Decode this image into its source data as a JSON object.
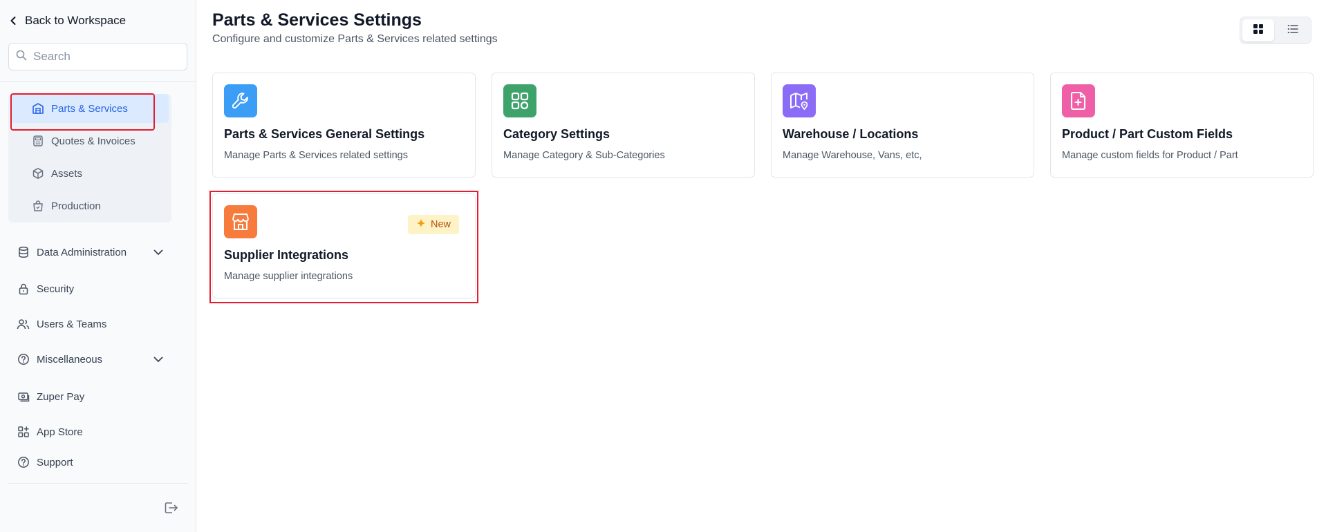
{
  "sidebar": {
    "back_label": "Back to Workspace",
    "search_placeholder": "Search",
    "submenu": [
      {
        "label": "Parts & Services",
        "icon": "building-icon",
        "active": true
      },
      {
        "label": "Quotes & Invoices",
        "icon": "calculator-icon",
        "active": false
      },
      {
        "label": "Assets",
        "icon": "cube-icon",
        "active": false
      },
      {
        "label": "Production",
        "icon": "shopping-bag-icon",
        "active": false
      }
    ],
    "nav": [
      {
        "label": "Data Administration",
        "icon": "database-icon",
        "expandable": true
      },
      {
        "label": "Security",
        "icon": "lock-icon",
        "expandable": false
      },
      {
        "label": "Users & Teams",
        "icon": "users-icon",
        "expandable": false
      },
      {
        "label": "Miscellaneous",
        "icon": "help-circle-icon",
        "expandable": true
      },
      {
        "label": "Zuper Pay",
        "icon": "payment-icon",
        "expandable": false
      },
      {
        "label": "App Store",
        "icon": "apps-grid-icon",
        "expandable": false
      },
      {
        "label": "Support",
        "icon": "question-circle-icon",
        "expandable": false
      }
    ]
  },
  "header": {
    "title": "Parts & Services Settings",
    "subtitle": "Configure and customize Parts & Services related settings"
  },
  "view_toggle": {
    "selected": "grid",
    "options": [
      "grid-view-icon",
      "list-view-icon"
    ]
  },
  "cards": [
    {
      "title": "Parts & Services General Settings",
      "description": "Manage Parts & Services related settings",
      "icon": "wrench-icon",
      "color": "#3b9df5"
    },
    {
      "title": "Category Settings",
      "description": "Manage Category & Sub-Categories",
      "icon": "category-grid-icon",
      "color": "#3ea36b"
    },
    {
      "title": "Warehouse / Locations",
      "description": "Manage Warehouse, Vans, etc,",
      "icon": "map-pin-icon",
      "color": "#8b6cf6"
    },
    {
      "title": "Product / Part Custom Fields",
      "description": "Manage custom fields for Product / Part",
      "icon": "file-plus-icon",
      "color": "#ef5fa7"
    },
    {
      "title": "Supplier Integrations",
      "description": "Manage supplier integrations",
      "icon": "store-icon",
      "color": "#f77b3c",
      "badge": "New"
    }
  ],
  "colors": {
    "accent": "#2563eb",
    "highlight": "#e11d2e",
    "badge_bg": "#fef3c7",
    "badge_text": "#b45309"
  }
}
